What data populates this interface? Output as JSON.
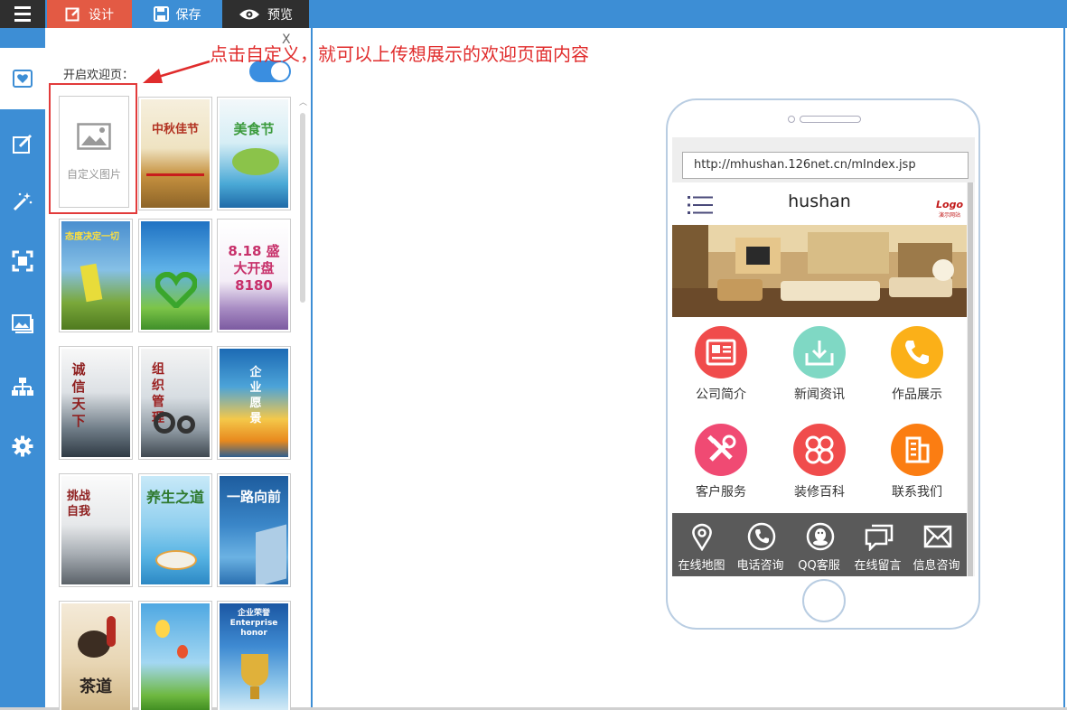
{
  "toolbar": {
    "design_label": "设计",
    "save_label": "保存",
    "preview_label": "预览"
  },
  "sidenav": {
    "items": [
      "heart-icon",
      "edit-icon",
      "magic-wand-icon",
      "fullscreen-icon",
      "image-icon",
      "sitemap-icon",
      "gear-icon"
    ]
  },
  "panel": {
    "close_label": "X",
    "welcome_label": "开启欢迎页：",
    "toggle_on": true,
    "custom_image_label": "自定义图片",
    "thumbnails": [
      {
        "text": "中秋佳节"
      },
      {
        "text": "美食节"
      },
      {
        "text": "态度决定一切"
      },
      {
        "text": ""
      },
      {
        "text": "8.18 盛大开盘 8180"
      },
      {
        "text": "诚信天下"
      },
      {
        "text": "组织管理"
      },
      {
        "text": "企业愿景"
      },
      {
        "text": "挑战自我"
      },
      {
        "text": "养生之道"
      },
      {
        "text": "一路向前"
      },
      {
        "text": "茶道"
      },
      {
        "text": ""
      },
      {
        "text": "企业荣誉 Enterprise honor"
      }
    ]
  },
  "annotation": {
    "text": "点击自定义，就可以上传想展示的欢迎页面内容"
  },
  "phone": {
    "url": "http://mhushan.126net.cn/mIndex.jsp",
    "site_title": "hushan",
    "logo_text": "Logo",
    "logo_sub": "演示网站",
    "grid": [
      {
        "label": "公司简介",
        "color": "#f04c4c",
        "icon": "newspaper-icon"
      },
      {
        "label": "新闻资讯",
        "color": "#7fd8c4",
        "icon": "download-icon"
      },
      {
        "label": "作品展示",
        "color": "#fbb018",
        "icon": "phone-icon"
      },
      {
        "label": "客户服务",
        "color": "#f04a73",
        "icon": "tools-icon"
      },
      {
        "label": "装修百科",
        "color": "#f04c4c",
        "icon": "clover-icon"
      },
      {
        "label": "联系我们",
        "color": "#fb7d12",
        "icon": "building-icon"
      }
    ],
    "footer": [
      {
        "label": "在线地图",
        "icon": "map-pin-icon"
      },
      {
        "label": "电话咨询",
        "icon": "phone-icon"
      },
      {
        "label": "QQ客服",
        "icon": "qq-icon"
      },
      {
        "label": "在线留言",
        "icon": "message-icon"
      },
      {
        "label": "信息咨询",
        "icon": "mail-icon"
      }
    ]
  }
}
